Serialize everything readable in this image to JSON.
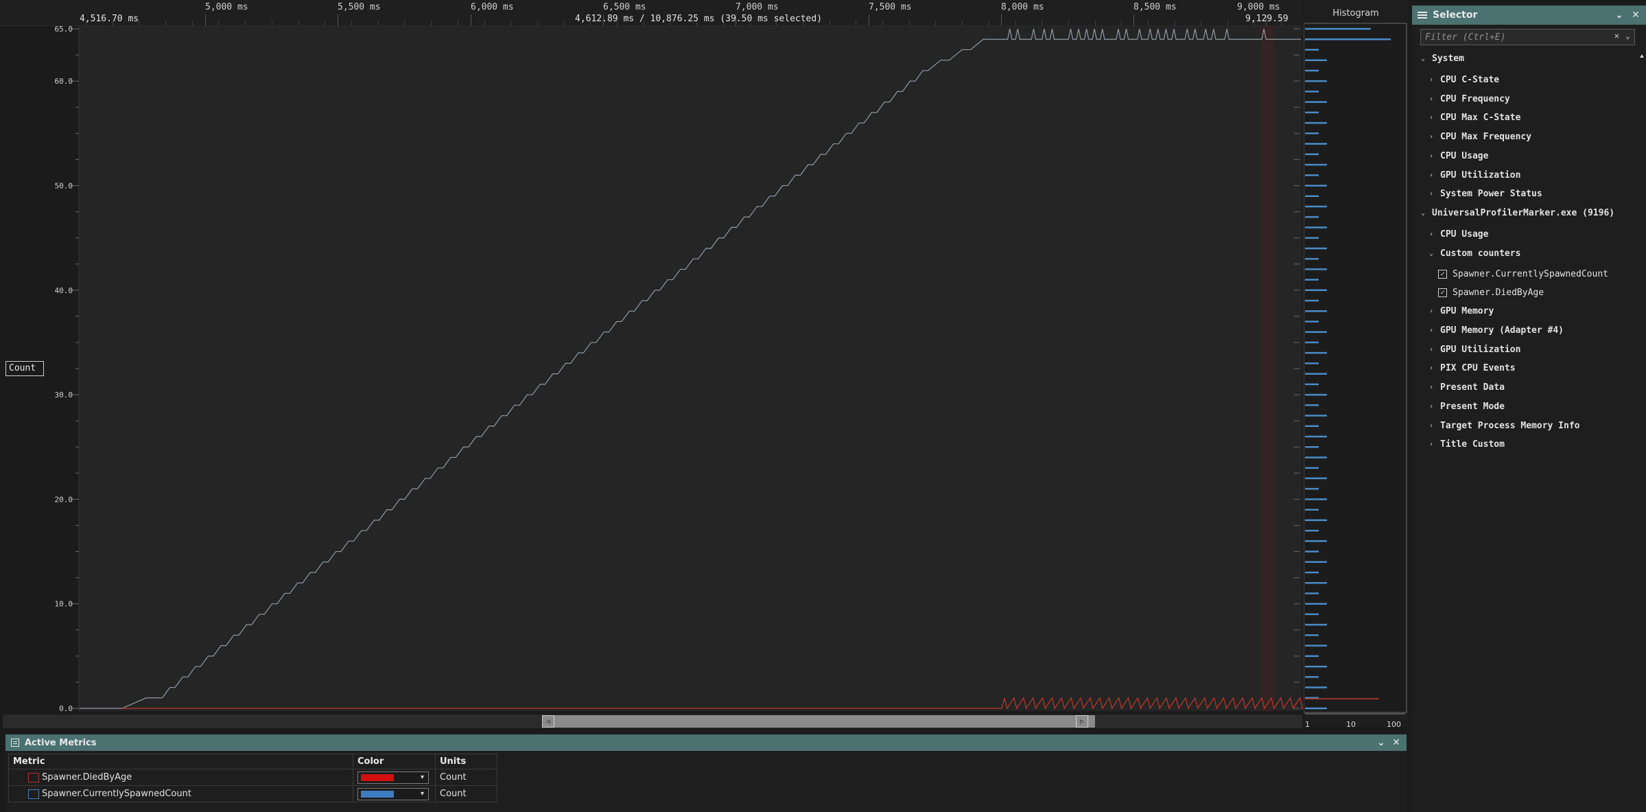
{
  "timeline": {
    "ticks": [
      "5,000 ms",
      "5,500 ms",
      "6,000 ms",
      "6,500 ms",
      "7,000 ms",
      "7,500 ms",
      "8,000 ms",
      "8,500 ms",
      "9,000 ms"
    ],
    "range_start": "4,516.70 ms",
    "range_end": "9,129.59 ms",
    "selection_info": "4,612.89 ms / 10,876.25 ms (39.50 ms selected)"
  },
  "graph": {
    "y_axis_unit": "Count",
    "y_tick_labels": [
      "65.0",
      "60.0",
      "50.0",
      "40.0",
      "30.0",
      "20.0",
      "10.0",
      "0.0"
    ]
  },
  "chart_data": {
    "type": "line",
    "xlabel": "",
    "ylabel": "Count",
    "xlim_ms": [
      4516.7,
      9129.59
    ],
    "ylim": [
      0,
      65
    ],
    "series": [
      {
        "name": "Spawner.CurrentlySpawnedCount",
        "color": "#8f9aa6",
        "step_x_ms": [
          4677,
          4829,
          5070,
          5311,
          5552,
          5793,
          6034,
          6275,
          6516,
          6757,
          6998,
          7239,
          7480,
          7721,
          7962
        ],
        "y_at_step": [
          0,
          1,
          6,
          11,
          16,
          21,
          26,
          31,
          36,
          41,
          46,
          51,
          56,
          61,
          64
        ],
        "plateau_y": 64,
        "plateau_oscillation": [
          64,
          65
        ]
      },
      {
        "name": "Spawner.DiedByAge",
        "color": "#c0392b",
        "points": [
          [
            4677,
            0
          ],
          [
            7962,
            0
          ],
          [
            9129.59,
            0
          ]
        ],
        "oscillation_start_ms": 8000,
        "oscillation_range": [
          0,
          1
        ]
      }
    ]
  },
  "histogram": {
    "title": "Histogram",
    "x_tick_labels": [
      "1",
      "10",
      "100"
    ],
    "bar_color": "#4a8cc7"
  },
  "active_metrics": {
    "title": "Active Metrics",
    "columns": [
      "Metric",
      "Color",
      "Units"
    ],
    "rows": [
      {
        "metric": "Spawner.DiedByAge",
        "color": "#d40f0f",
        "units": "Count"
      },
      {
        "metric": "Spawner.CurrentlySpawnedCount",
        "color": "#3e7cc0",
        "units": "Count"
      }
    ]
  },
  "selector": {
    "title": "Selector",
    "filter_placeholder": "Filter (Ctrl+E)",
    "tree": [
      {
        "label": "System",
        "level": 0,
        "expanded": true
      },
      {
        "label": "CPU C-State",
        "level": 1,
        "expanded": false
      },
      {
        "label": "CPU Frequency",
        "level": 1,
        "expanded": false
      },
      {
        "label": "CPU Max C-State",
        "level": 1,
        "expanded": false
      },
      {
        "label": "CPU Max Frequency",
        "level": 1,
        "expanded": false
      },
      {
        "label": "CPU Usage",
        "level": 1,
        "expanded": false
      },
      {
        "label": "GPU Utilization",
        "level": 1,
        "expanded": false
      },
      {
        "label": "System Power Status",
        "level": 1,
        "expanded": false
      },
      {
        "label": "UniversalProfilerMarker.exe (9196)",
        "level": 0,
        "expanded": true
      },
      {
        "label": "CPU Usage",
        "level": 1,
        "expanded": false
      },
      {
        "label": "Custom counters",
        "level": 1,
        "expanded": true
      },
      {
        "label": "Spawner.CurrentlySpawnedCount",
        "level": 2,
        "checked": true
      },
      {
        "label": "Spawner.DiedByAge",
        "level": 2,
        "checked": true
      },
      {
        "label": "GPU Memory",
        "level": 1,
        "expanded": false
      },
      {
        "label": "GPU Memory (Adapter #4)",
        "level": 1,
        "expanded": false
      },
      {
        "label": "GPU Utilization",
        "level": 1,
        "expanded": false
      },
      {
        "label": "PIX CPU Events",
        "level": 1,
        "expanded": false
      },
      {
        "label": "Present Data",
        "level": 1,
        "expanded": false
      },
      {
        "label": "Present Mode",
        "level": 1,
        "expanded": false
      },
      {
        "label": "Target Process Memory Info",
        "level": 1,
        "expanded": false
      },
      {
        "label": "Title Custom",
        "level": 1,
        "expanded": false
      }
    ]
  },
  "colors": {
    "panel_title_bg": "#4b7171",
    "graph_bg": "#252525",
    "selection_band": "#3a2222"
  }
}
